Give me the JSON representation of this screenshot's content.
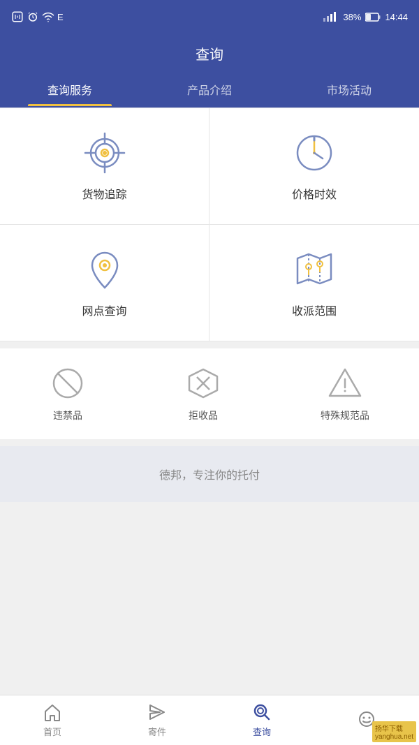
{
  "statusBar": {
    "time": "14:44",
    "battery": "38%",
    "signal": "E"
  },
  "header": {
    "title": "查询"
  },
  "tabs": [
    {
      "id": "query-service",
      "label": "查询服务",
      "active": true
    },
    {
      "id": "product-intro",
      "label": "产品介绍",
      "active": false
    },
    {
      "id": "market-activity",
      "label": "市场活动",
      "active": false
    }
  ],
  "serviceItems": [
    {
      "id": "cargo-tracking",
      "label": "货物追踪",
      "icon": "target"
    },
    {
      "id": "price-timeliness",
      "label": "价格时效",
      "icon": "clock"
    },
    {
      "id": "outlet-query",
      "label": "网点查询",
      "icon": "location"
    },
    {
      "id": "pickup-range",
      "label": "收派范围",
      "icon": "map"
    }
  ],
  "infoItems": [
    {
      "id": "prohibited",
      "label": "违禁品",
      "icon": "prohibited"
    },
    {
      "id": "rejected",
      "label": "拒收品",
      "icon": "rejected"
    },
    {
      "id": "special-regulated",
      "label": "特殊规范品",
      "icon": "warning"
    }
  ],
  "slogan": "德邦，专注你的托付",
  "navItems": [
    {
      "id": "home",
      "label": "首页",
      "active": false
    },
    {
      "id": "send",
      "label": "寄件",
      "active": false
    },
    {
      "id": "query",
      "label": "查询",
      "active": true
    }
  ],
  "watermark": "扬华下载\nyanghua.net",
  "colors": {
    "primary": "#3d4fa0",
    "accent": "#f0c040",
    "iconColor": "#7a8cc0",
    "iconStroke": "#8899cc"
  }
}
